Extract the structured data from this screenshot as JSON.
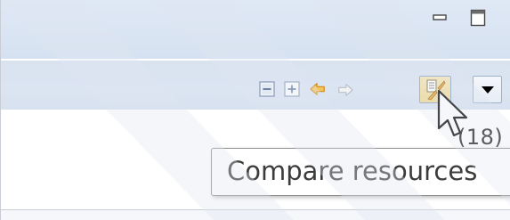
{
  "window": {
    "minimize_icon": "minimize-icon",
    "maximize_icon": "maximize-icon"
  },
  "toolbar": {
    "collapse_icon": "collapse-all-icon",
    "expand_icon": "expand-all-icon",
    "back_icon": "back-arrow-icon",
    "forward_icon": "forward-arrow-icon",
    "compare_icon": "compare-resources-icon",
    "dropdown_icon": "chevron-down-icon"
  },
  "partial_label": "(18)",
  "tooltip": {
    "text": "Compare resources"
  },
  "colors": {
    "chrome_blue": "#d6e2f1",
    "compare_highlight": "#f2d98f",
    "arrow_orange": "#f0a830"
  }
}
